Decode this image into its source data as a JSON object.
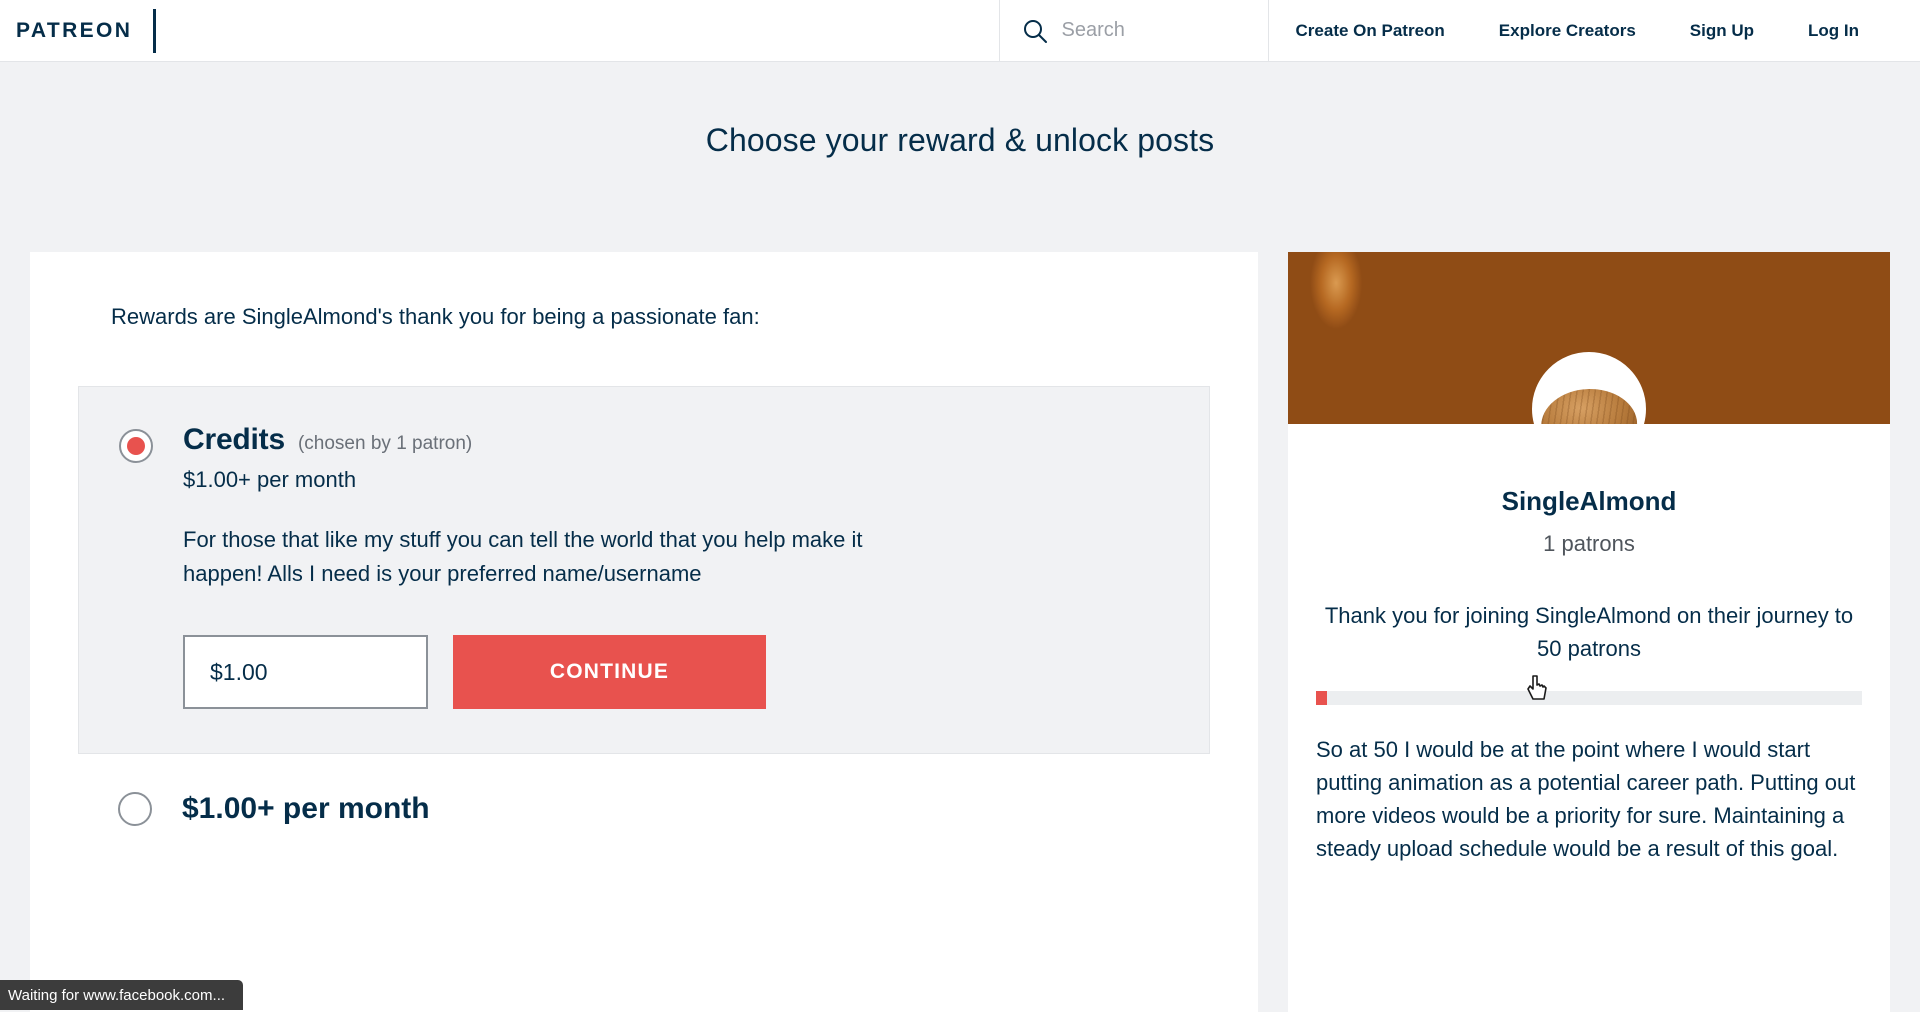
{
  "header": {
    "wordmark": "PATREON",
    "search": {
      "placeholder": "Search",
      "value": "",
      "icon": "search-icon"
    },
    "nav": [
      {
        "label": "Create On Patreon"
      },
      {
        "label": "Explore Creators"
      },
      {
        "label": "Sign Up"
      },
      {
        "label": "Log In"
      }
    ]
  },
  "page": {
    "title": "Choose your reward & unlock posts"
  },
  "rewards": {
    "intro": "Rewards are SingleAlmond's thank you for being a passionate fan:",
    "tiers": [
      {
        "name": "Credits",
        "chosen": "(chosen by 1 patron)",
        "price": "$1.00+ per month",
        "description": "For those that like my stuff you can tell the world that you help make it happen! Alls I need is your preferred name/username",
        "amount_value": "$1.00",
        "amount_placeholder": "$1.00",
        "continue_label": "CONTINUE",
        "selected": true
      },
      {
        "name": "$1.00+ per month",
        "selected": false
      }
    ]
  },
  "creator": {
    "name": "SingleAlmond",
    "patrons": "1 patrons",
    "goal_headline": "Thank you for joining SingleAlmond on their journey to 50 patrons",
    "goal_progress_percent": 2,
    "goal_description": "So at 50 I would be at the point where I would start putting animation as a potential career path. Putting out more videos would be a priority for sure. Maintaining a steady upload schedule would be a result of this goal.",
    "banner_alt": "almonds-banner-image",
    "avatar_alt": "almond-avatar-image"
  },
  "status_bar": {
    "text": "Waiting for www.facebook.com..."
  },
  "colors": {
    "accent": "#e8524e",
    "text": "#052d49",
    "page_bg": "#f1f2f4",
    "card_bg": "#ffffff",
    "muted": "#6a7078"
  }
}
